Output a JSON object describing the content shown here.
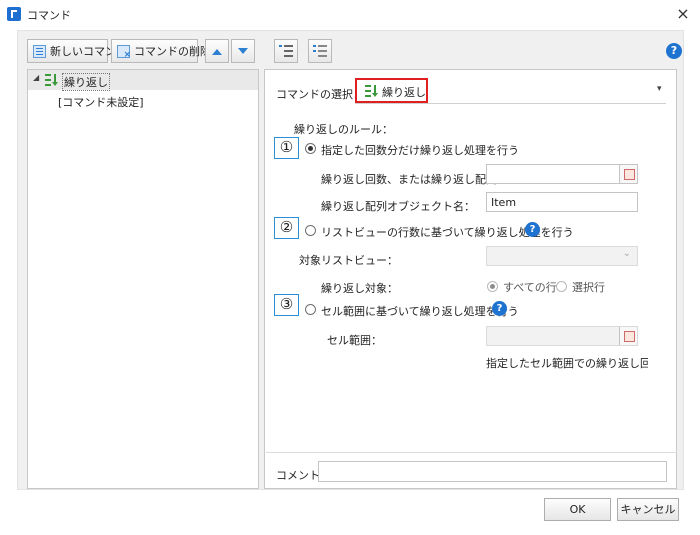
{
  "window": {
    "title": "コマンド",
    "close": "×"
  },
  "toolbar": {
    "new_command": "新しいコマンド",
    "delete_command": "コマンドの削除",
    "help": "?"
  },
  "tree": {
    "items": [
      {
        "label": "繰り返し",
        "expander": "◢"
      },
      {
        "label": "[コマンド未設定]"
      }
    ]
  },
  "command_select": {
    "label": "コマンドの選択：",
    "value": "繰り返し",
    "arrow": "▾"
  },
  "rule": {
    "label": "繰り返しのルール：",
    "options": [
      {
        "marker": "①",
        "label": "指定した回数分だけ繰り返し処理を行う",
        "selected": true
      },
      {
        "marker": "②",
        "label": "リストビューの行数に基づいて繰り返し処理を行う",
        "selected": false
      },
      {
        "marker": "③",
        "label": "セル範囲に基づいて繰り返し処理を行う",
        "selected": false
      }
    ]
  },
  "repeat_count": {
    "label": "繰り返し回数、または繰り返し配列：",
    "value": ""
  },
  "array_object": {
    "label": "繰り返し配列オブジェクト名：",
    "value": "Item"
  },
  "listview": {
    "target_label": "対象リストビュー：",
    "target_value": "",
    "arrow": "⌄",
    "repeat_target_label": "繰り返し対象：",
    "all_rows": "すべての行",
    "selected_rows": "選択行"
  },
  "cell_range": {
    "label": "セル範囲：",
    "value": "",
    "note": "指定したセル範囲での繰り返し回数は"
  },
  "comment": {
    "label": "コメント",
    "value": ""
  },
  "buttons": {
    "ok": "OK",
    "cancel": "キャンセル"
  },
  "colors": {
    "accent": "#1f73d0",
    "highlight_border": "#e02020",
    "marker_border": "#2b8fd6"
  }
}
